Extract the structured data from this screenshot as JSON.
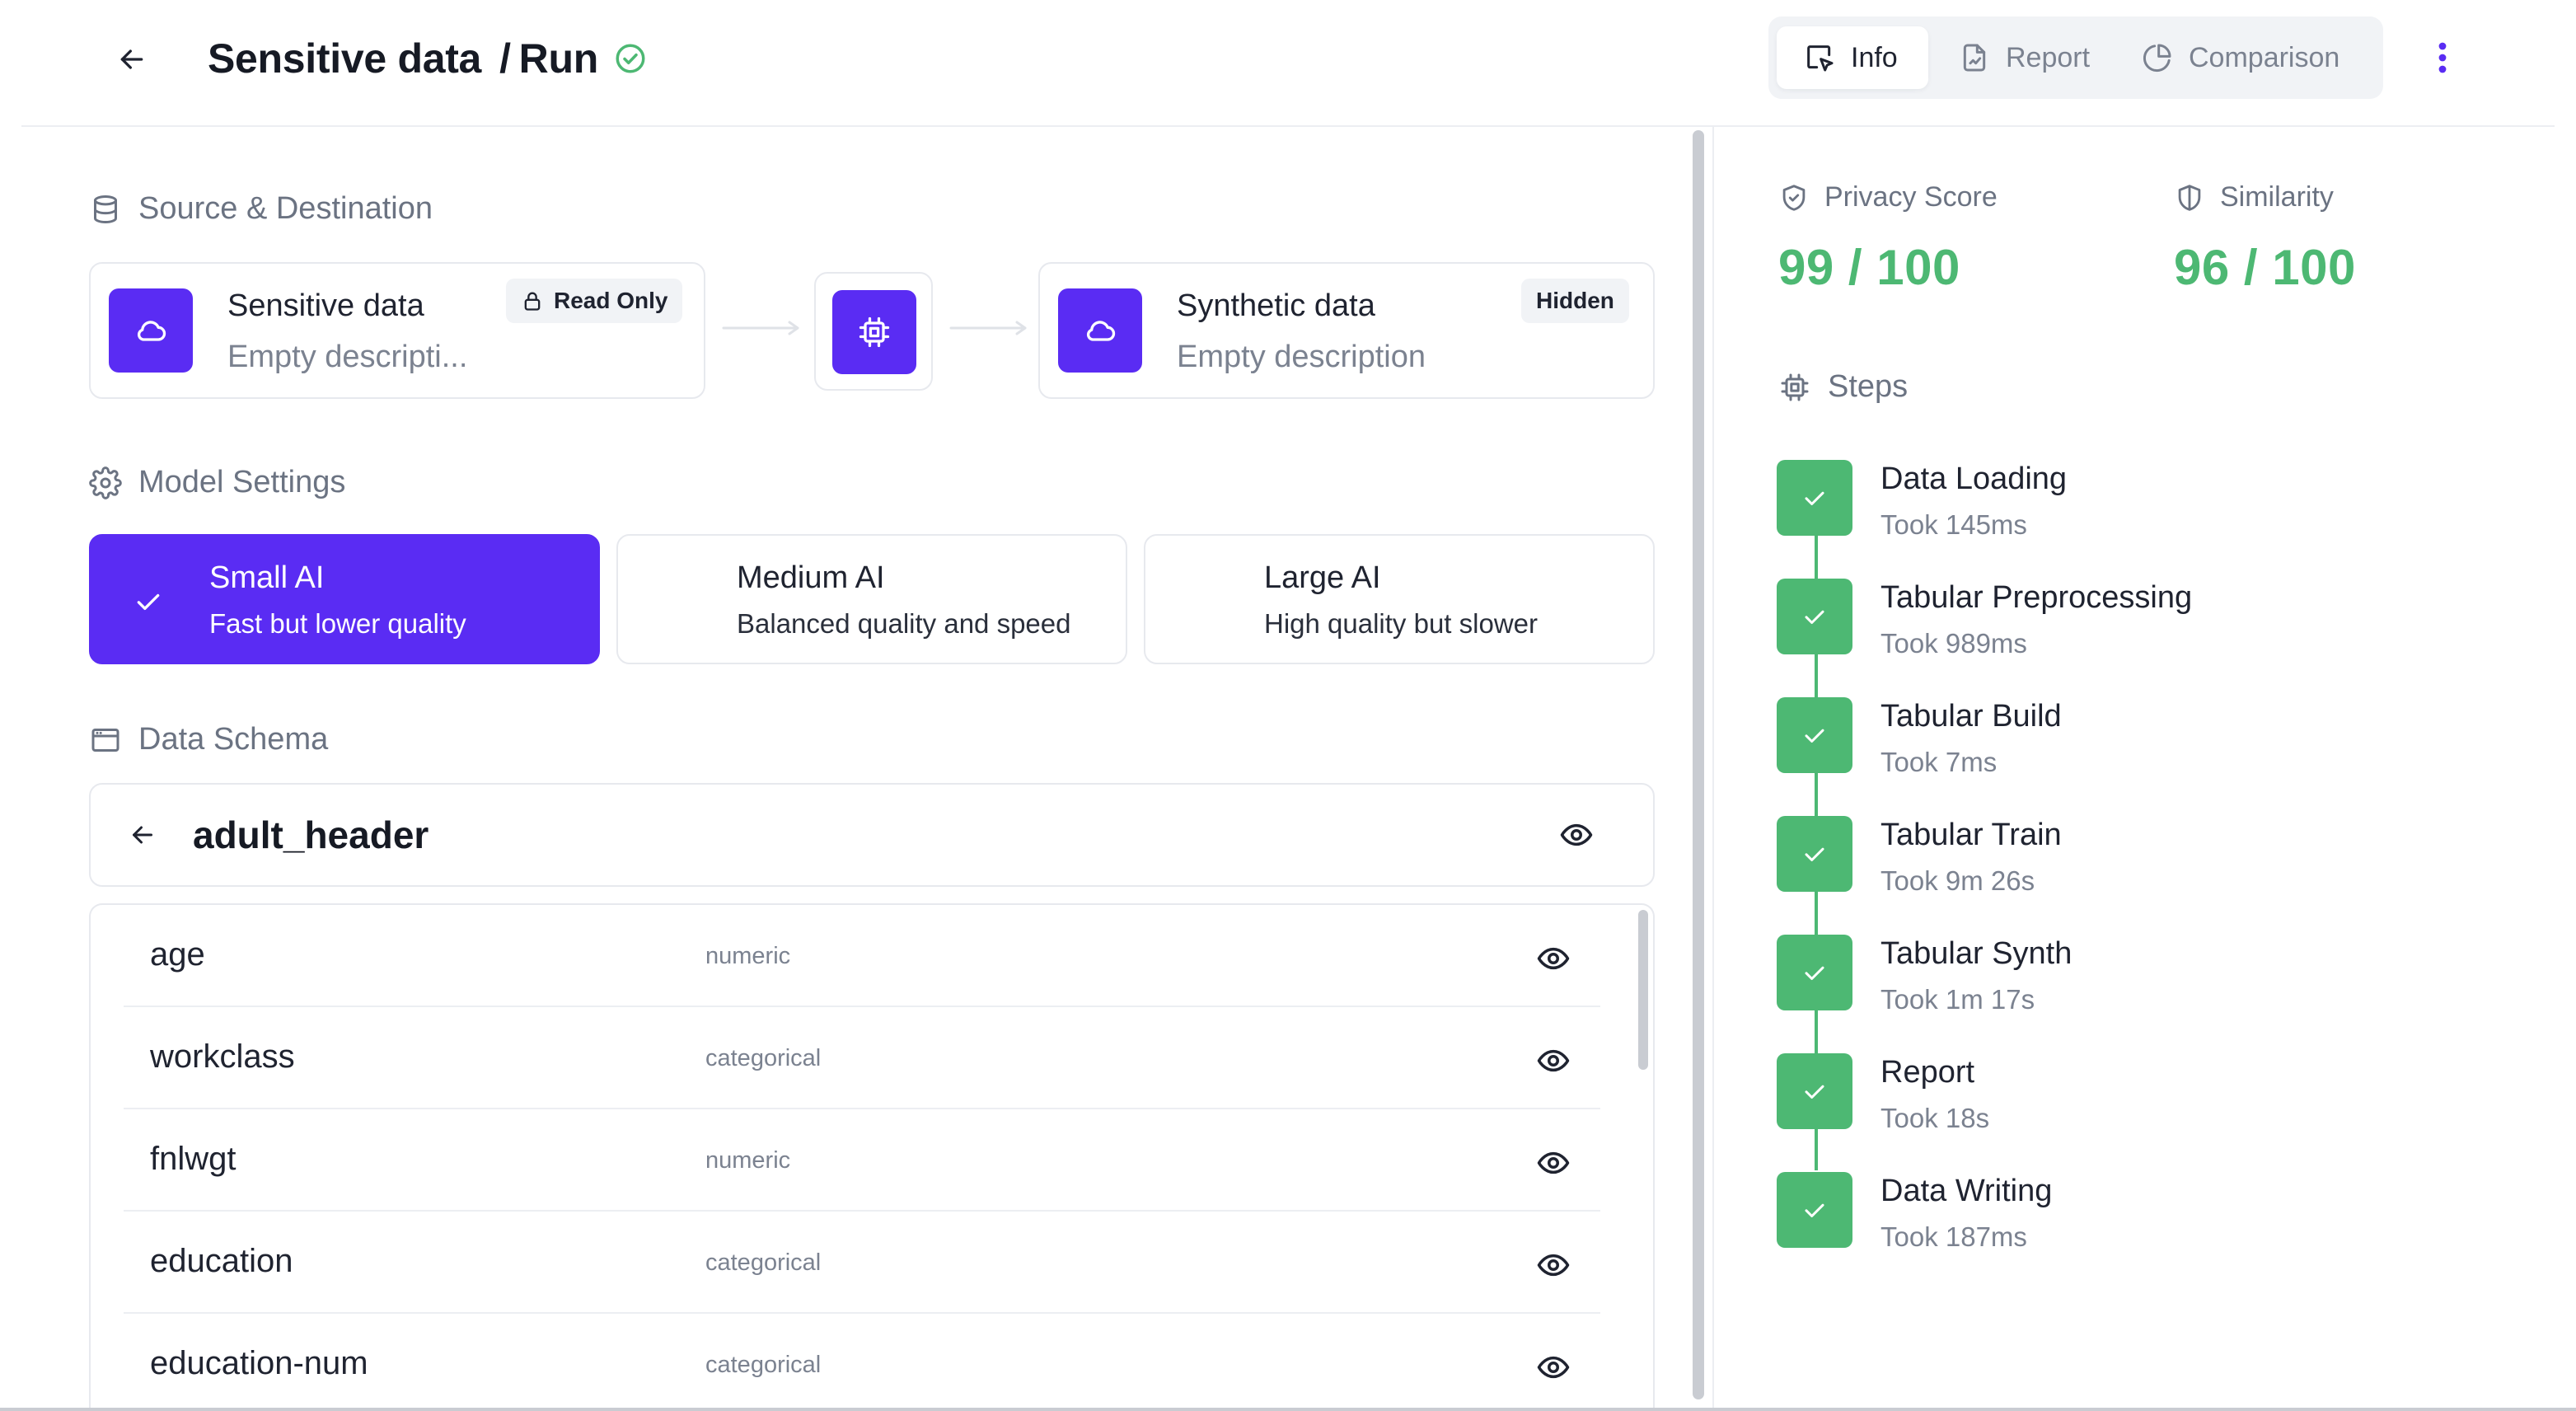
{
  "header": {
    "title": "Sensitive data",
    "separator": "/",
    "subtitle": "Run",
    "status_icon": "check-circle-icon",
    "tabs": [
      {
        "label": "Info",
        "icon": "cursor-select-icon",
        "active": true
      },
      {
        "label": "Report",
        "icon": "document-chart-icon",
        "active": false
      },
      {
        "label": "Comparison",
        "icon": "pie-chart-icon",
        "active": false
      }
    ],
    "more_icon": "kebab-menu-icon"
  },
  "source_destination": {
    "title": "Source & Destination",
    "source": {
      "name": "Sensitive data",
      "description": "Empty descripti...",
      "badge": "Read Only",
      "icon": "cloud-icon"
    },
    "processor": {
      "icon": "chip-icon"
    },
    "destination": {
      "name": "Synthetic data",
      "description": "Empty description",
      "badge": "Hidden",
      "icon": "cloud-icon"
    }
  },
  "model_settings": {
    "title": "Model Settings",
    "options": [
      {
        "name": "Small AI",
        "description": "Fast but lower quality",
        "selected": true
      },
      {
        "name": "Medium AI",
        "description": "Balanced quality and speed",
        "selected": false
      },
      {
        "name": "Large AI",
        "description": "High quality but slower",
        "selected": false
      }
    ]
  },
  "data_schema": {
    "title": "Data Schema",
    "table_name": "adult_header",
    "fields": [
      {
        "name": "age",
        "type": "numeric"
      },
      {
        "name": "workclass",
        "type": "categorical"
      },
      {
        "name": "fnlwgt",
        "type": "numeric"
      },
      {
        "name": "education",
        "type": "categorical"
      },
      {
        "name": "education-num",
        "type": "categorical"
      }
    ]
  },
  "metrics": {
    "privacy": {
      "label": "Privacy Score",
      "value": "99 / 100",
      "icon": "shield-check-icon"
    },
    "similarity": {
      "label": "Similarity",
      "value": "96 / 100",
      "icon": "shield-half-icon"
    }
  },
  "steps": {
    "title": "Steps",
    "items": [
      {
        "name": "Data Loading",
        "time": "Took 145ms"
      },
      {
        "name": "Tabular Preprocessing",
        "time": "Took 989ms"
      },
      {
        "name": "Tabular Build",
        "time": "Took 7ms"
      },
      {
        "name": "Tabular Train",
        "time": "Took 9m 26s"
      },
      {
        "name": "Tabular Synth",
        "time": "Took 1m 17s"
      },
      {
        "name": "Report",
        "time": "Took 18s"
      },
      {
        "name": "Data Writing",
        "time": "Took 187ms"
      }
    ]
  },
  "colors": {
    "accent": "#5a2cf3",
    "success": "#4db873",
    "muted_text": "#7b8290",
    "border": "#e7e9ee"
  }
}
